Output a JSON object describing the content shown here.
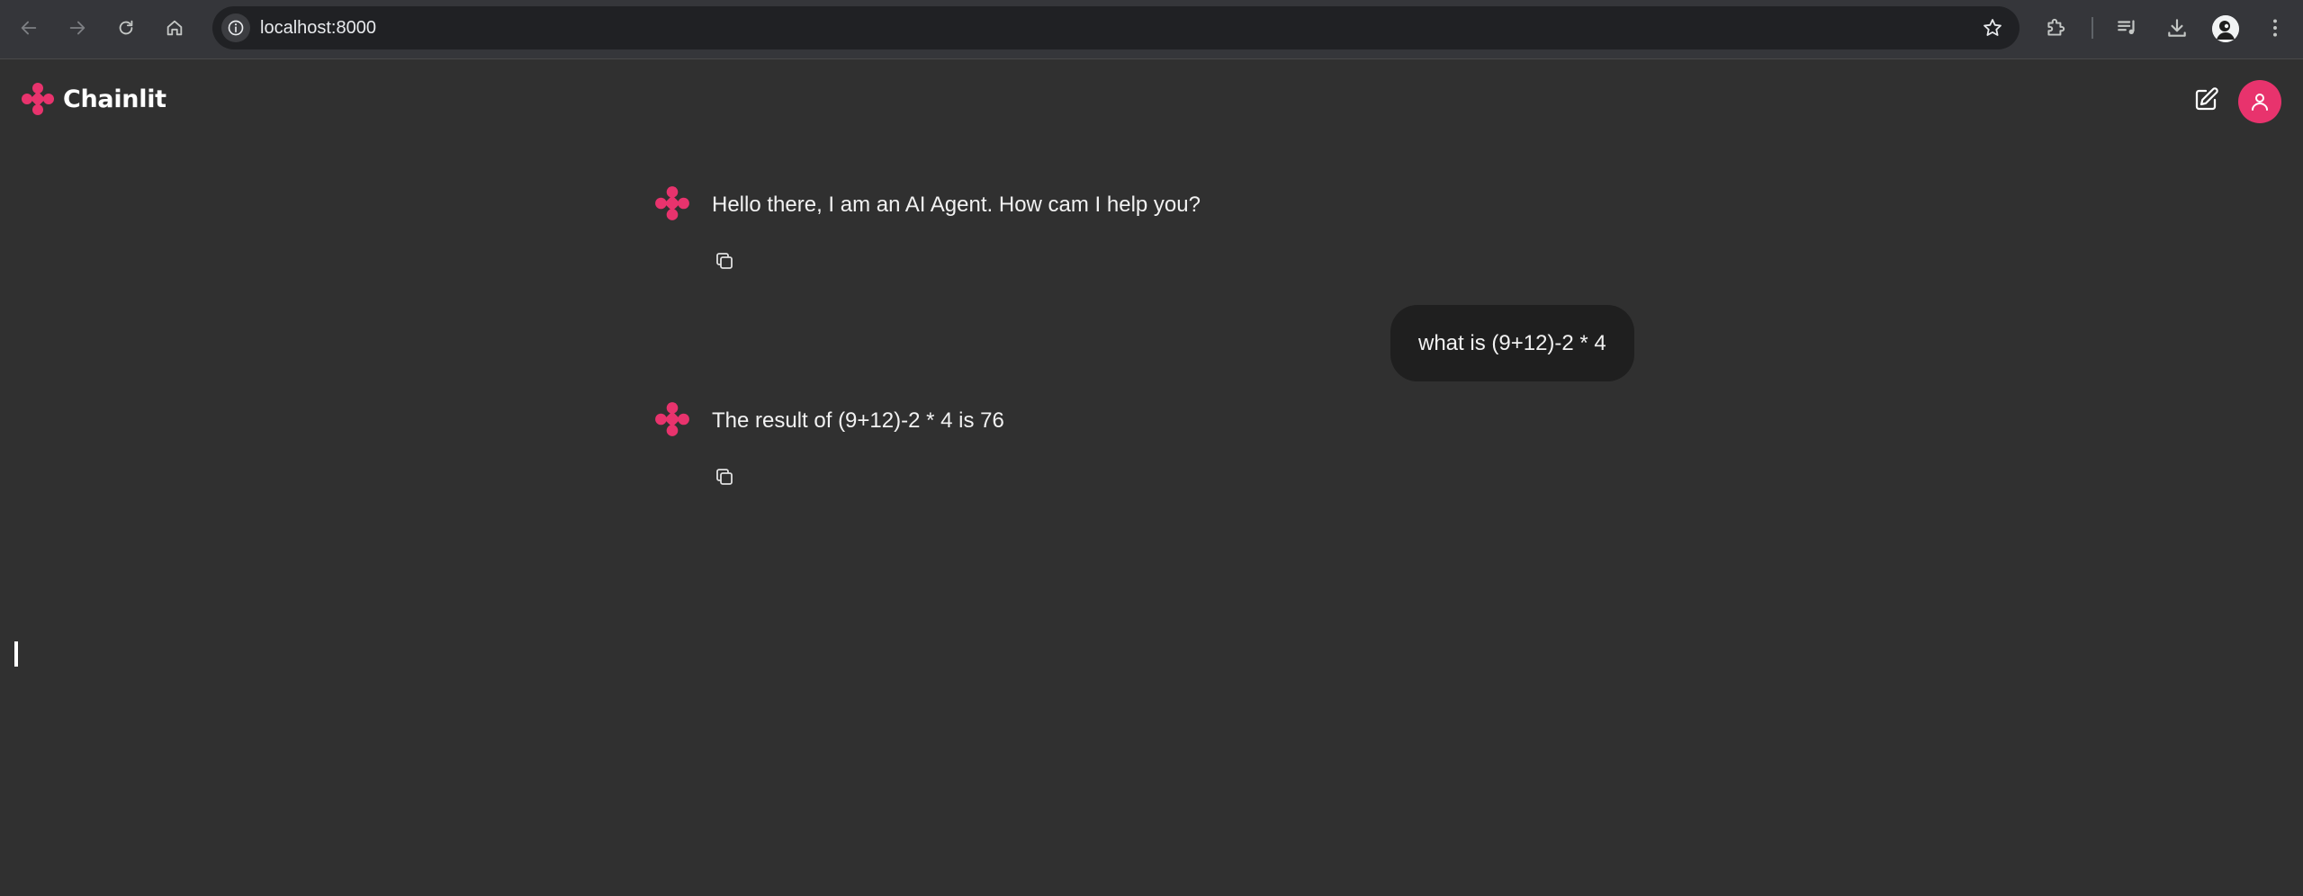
{
  "browser": {
    "url": "localhost:8000",
    "icons": {
      "back": "arrow-left-icon",
      "forward": "arrow-right-icon",
      "reload": "reload-icon",
      "home": "home-icon",
      "site_info": "info-icon",
      "bookmark": "star-icon",
      "extensions": "puzzle-icon",
      "media": "media-controls-icon",
      "downloads": "download-icon",
      "menu": "kebab-menu-icon"
    }
  },
  "app": {
    "name": "Chainlit",
    "brand_color": "#e8336d",
    "icons": {
      "new_chat": "edit-icon",
      "user": "user-icon",
      "copy": "copy-icon"
    }
  },
  "messages": [
    {
      "author": "assistant",
      "text": "Hello there, I am an AI Agent. How cam I help you?"
    },
    {
      "author": "user",
      "text": "what is (9+12)-2 * 4"
    },
    {
      "author": "assistant",
      "text": "The result of (9+12)-2 * 4 is 76"
    }
  ]
}
